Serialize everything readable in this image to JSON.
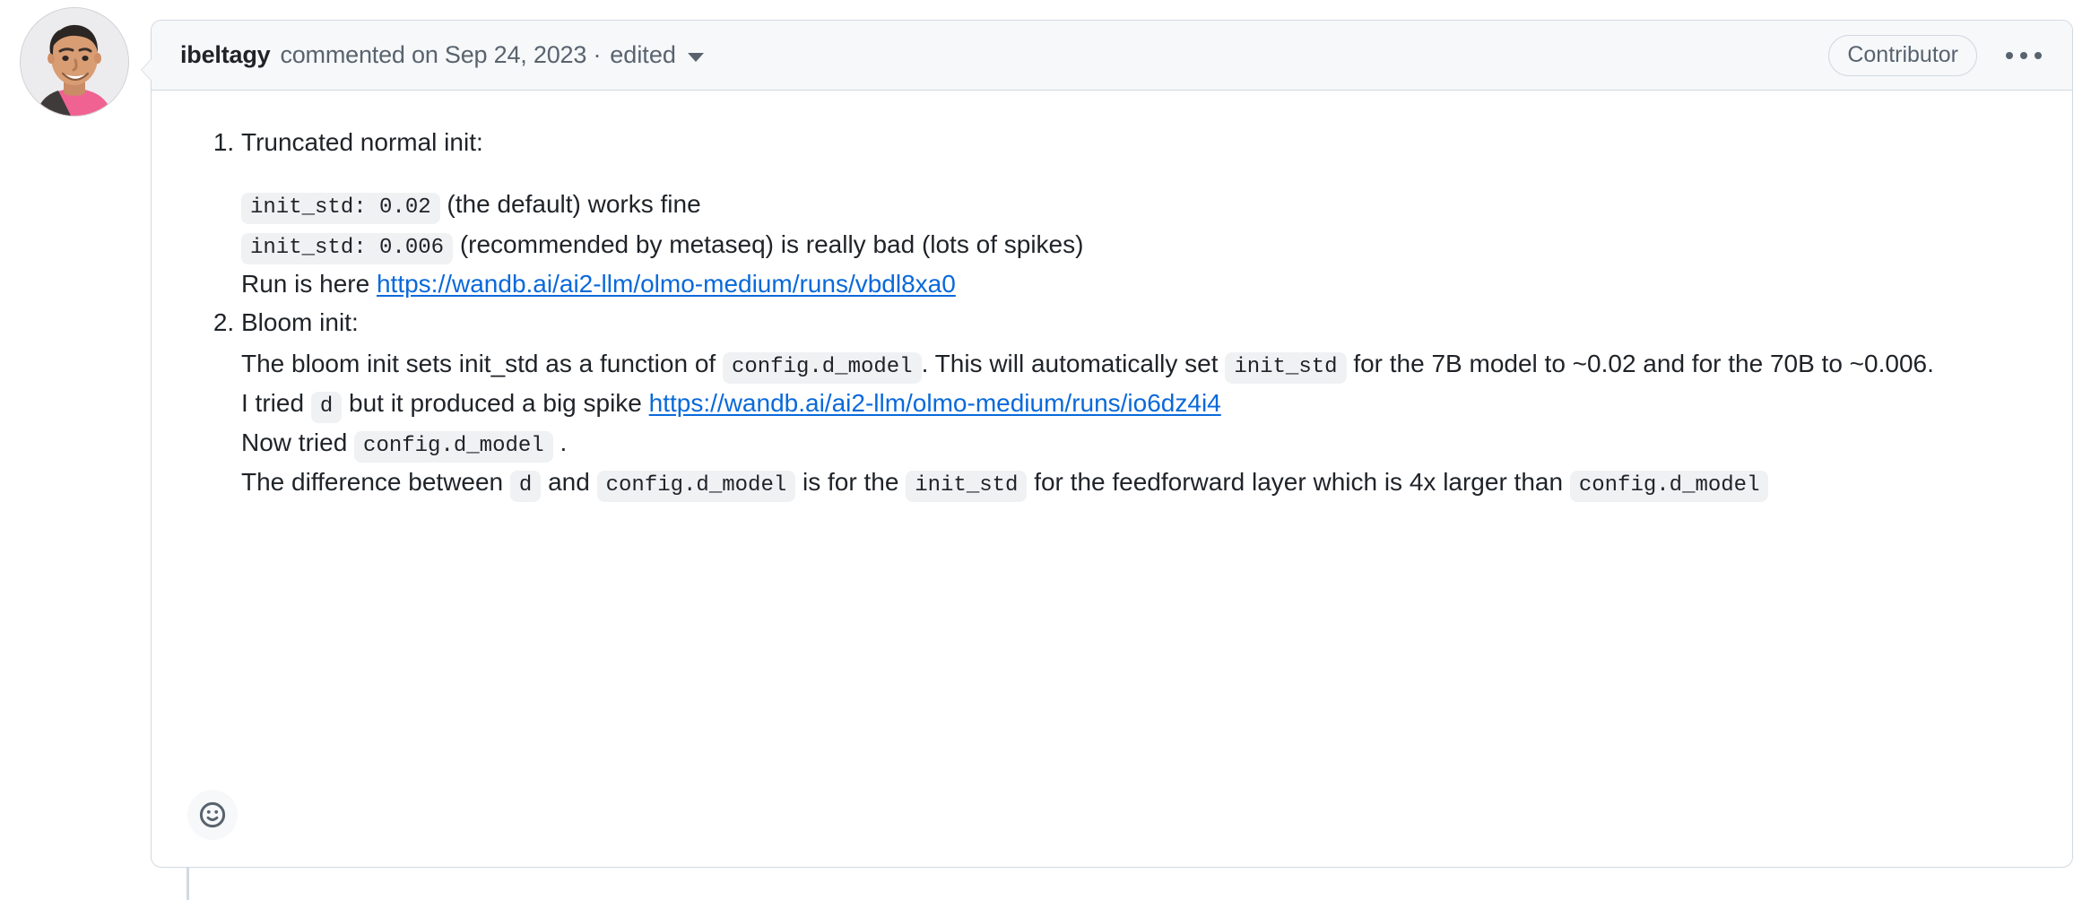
{
  "comment": {
    "author": "ibeltagy",
    "meta": "commented on Sep 24, 2023 ·",
    "edited_label": "edited",
    "badge": "Contributor",
    "menu_icon": "kebab-horizontal-icon",
    "caret_icon": "chevron-down-icon",
    "avatar_alt": "ibeltagy"
  },
  "body": {
    "item1": {
      "title": "Truncated normal init:",
      "line1": {
        "code": "init_std: 0.02",
        "text": "(the default) works fine"
      },
      "line2": {
        "code": "init_std: 0.006",
        "text": "(recommended by metaseq) is really bad (lots of spikes)"
      },
      "line3": {
        "prefix": "Run is here",
        "link_text": "https://wandb.ai/ai2-llm/olmo-medium/runs/vbdl8xa0",
        "link_href": "https://wandb.ai/ai2-llm/olmo-medium/runs/vbdl8xa0"
      }
    },
    "item2": {
      "title": "Bloom init:",
      "line1": {
        "t1": "The bloom init sets init_std as a function of",
        "c1": "config.d_model",
        "t2": ". This will automatically set",
        "c2": "init_std",
        "t3": "for the 7B model to ~0.02 and for the 70B to ~0.006."
      },
      "line2": {
        "t1": "I tried",
        "c1": "d",
        "t2": "but it produced a big spike",
        "link_text": "https://wandb.ai/ai2-llm/olmo-medium/runs/io6dz4i4",
        "link_href": "https://wandb.ai/ai2-llm/olmo-medium/runs/io6dz4i4"
      },
      "line3": {
        "t1": "Now tried",
        "c1": "config.d_model",
        "t2": "."
      },
      "line4": {
        "t1": "The difference between",
        "c1": "d",
        "t2": "and",
        "c2": "config.d_model",
        "t3": "is for the",
        "c3": "init_std",
        "t4": "for the feedforward layer which is 4x larger than",
        "c4": "config.d_model"
      }
    }
  },
  "reactions": {
    "add_reaction_icon": "smiley-icon"
  },
  "colors": {
    "link": "#0969da",
    "border": "#d1d9e0",
    "header_bg": "#f6f8fa",
    "code_bg": "#eff1f3",
    "muted_text": "#59636e",
    "text": "#1f2328"
  }
}
